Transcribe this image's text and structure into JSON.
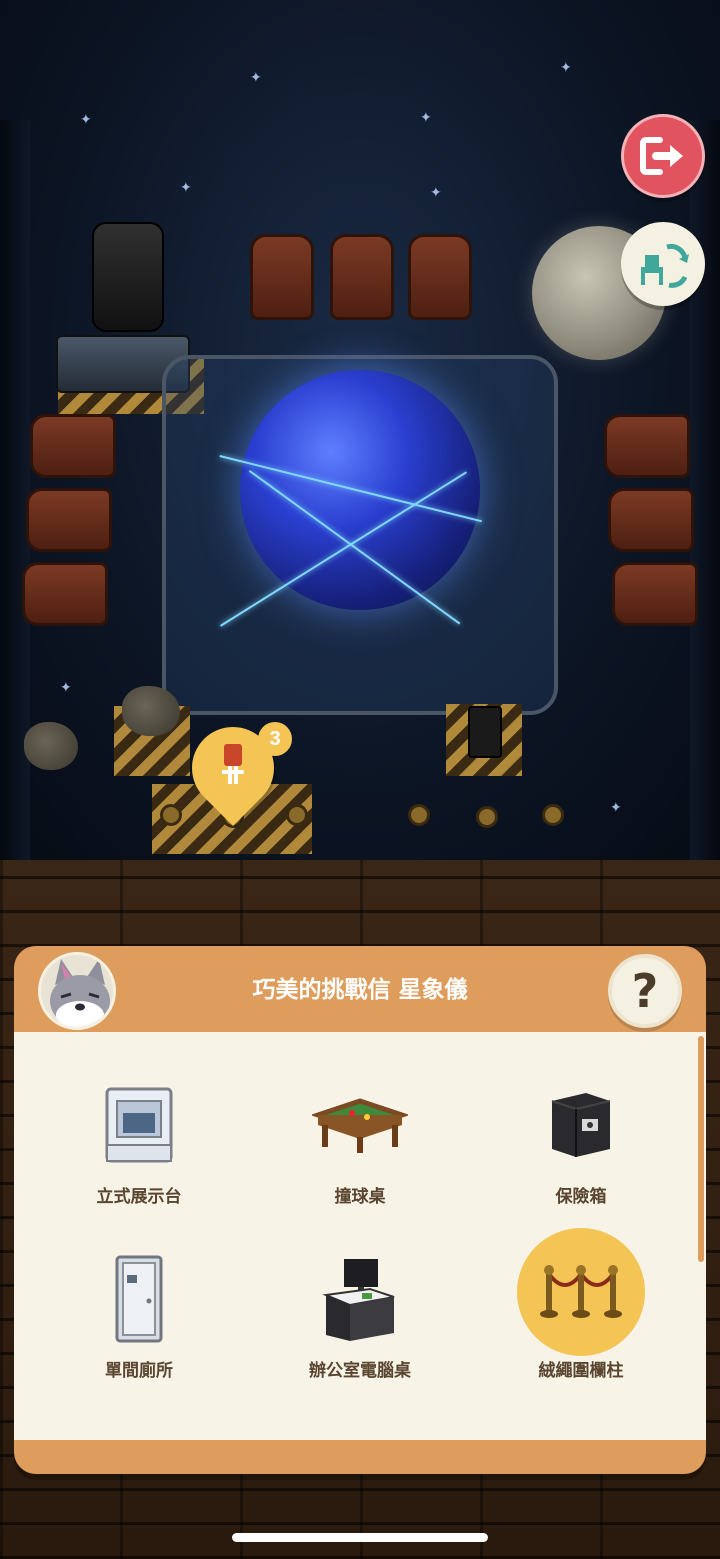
{
  "panel": {
    "title": "巧美的挑戰信 星象儀",
    "help_label": "?",
    "avatar_icon": "wolf-villager-avatar",
    "items": [
      {
        "label": "立式展示台",
        "icon": "display-stand-icon",
        "selected": false
      },
      {
        "label": "撞球桌",
        "icon": "pool-table-icon",
        "selected": false
      },
      {
        "label": "保險箱",
        "icon": "safe-icon",
        "selected": false
      },
      {
        "label": "單間廁所",
        "icon": "toilet-booth-icon",
        "selected": false
      },
      {
        "label": "辦公室電腦桌",
        "icon": "office-desk-icon",
        "selected": false
      },
      {
        "label": "絨繩圍欄柱",
        "icon": "rope-partition-icon",
        "selected": true
      }
    ]
  },
  "pin": {
    "badge": "3",
    "icon": "rope-post-pin-icon"
  },
  "buttons": {
    "exit_icon": "exit-door-icon",
    "swap_icon": "swap-furniture-icon"
  },
  "colors": {
    "panel": "#de9d5c",
    "panel_body": "#f7f3e6",
    "selected": "#f4c455",
    "exit": "#e0535f"
  }
}
